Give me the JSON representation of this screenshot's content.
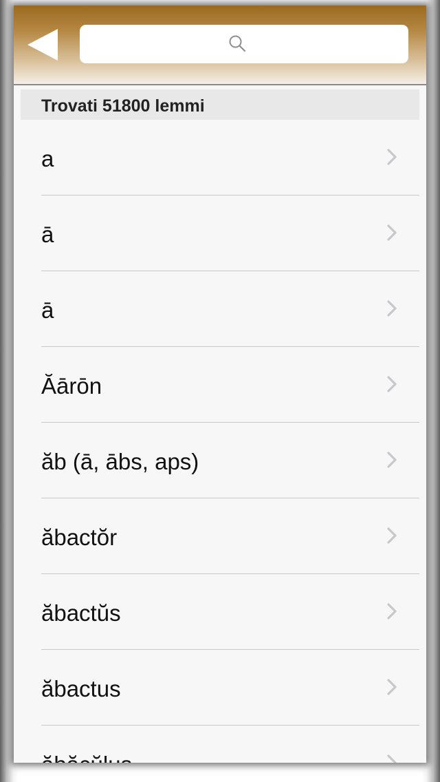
{
  "navbar": {
    "back_icon": "back-triangle-icon",
    "search": {
      "placeholder": "",
      "value": "",
      "icon": "search-icon"
    }
  },
  "results": {
    "header": "Trovati 51800 lemmi"
  },
  "list": {
    "chevron_icon": "chevron-right-icon",
    "items": [
      {
        "label": "a"
      },
      {
        "label": "ā"
      },
      {
        "label": "ā"
      },
      {
        "label": "Ăārōn"
      },
      {
        "label": "ăb (ā, ābs, aps)"
      },
      {
        "label": "ăbactŏr"
      },
      {
        "label": "ăbactŭs"
      },
      {
        "label": "ăbactus"
      },
      {
        "label": "ăbăcŭlus"
      }
    ]
  },
  "colors": {
    "navbar_top": "#9a6a1f",
    "navbar_bottom": "#f4efe7",
    "background": "#f7f7f7",
    "header_bg": "#e8e8e8",
    "chevron": "#c7c7cc"
  }
}
